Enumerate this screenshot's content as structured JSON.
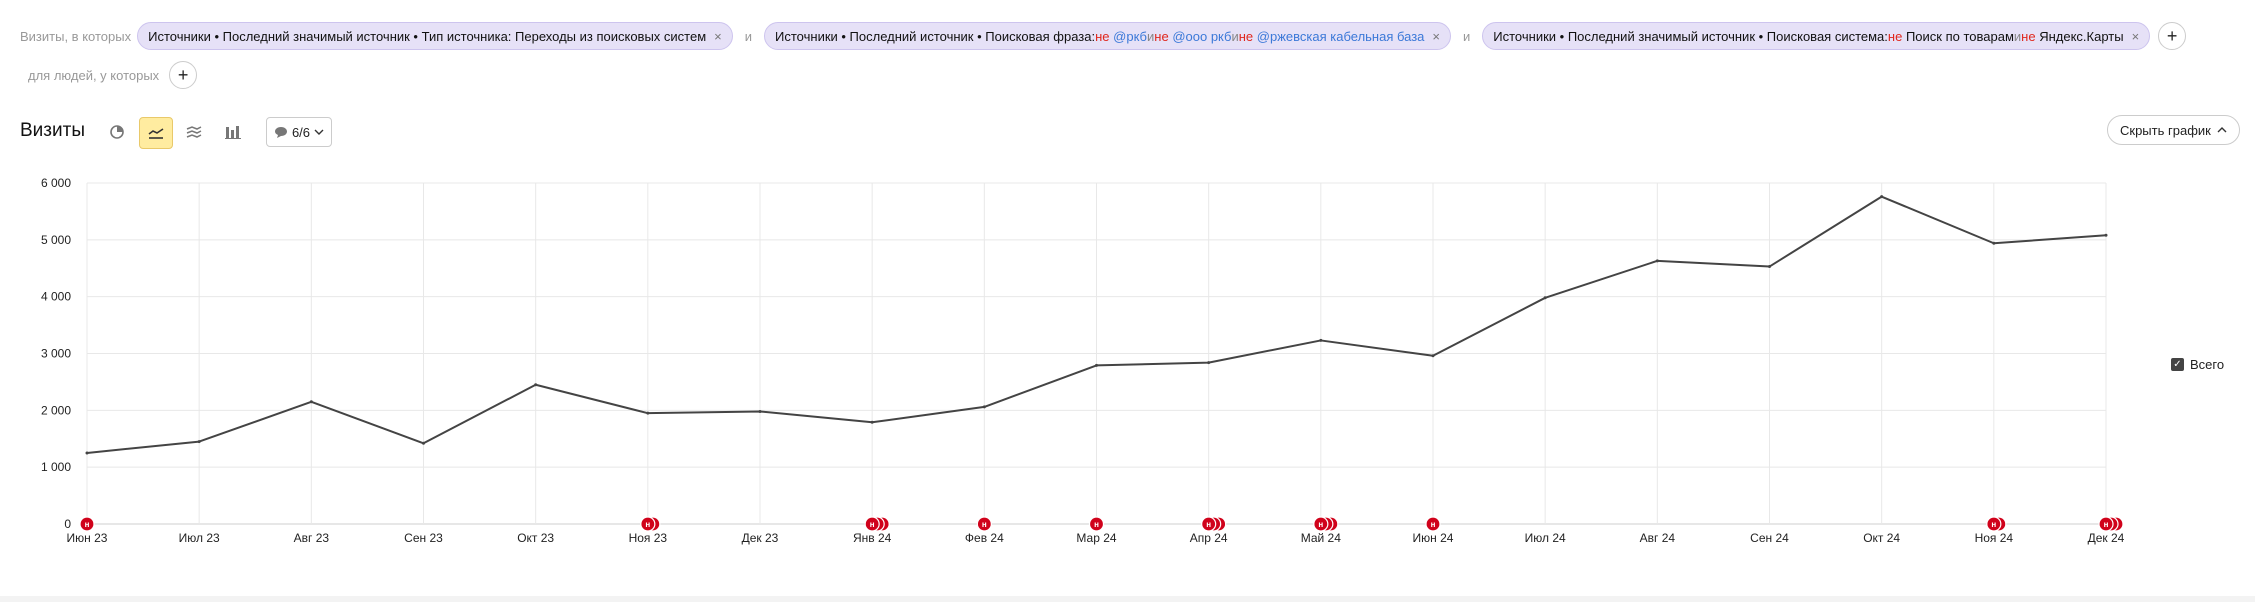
{
  "filters": {
    "lead": "Визиты, в которых",
    "conj": "и",
    "chip1": {
      "text": "Источники • Последний значимый источник • Тип источника: Переходы из поисковых систем"
    },
    "chip2": {
      "prefix": "Источники • Последний источник • Поисковая фраза: ",
      "not": "не",
      "and": " и ",
      "phrase1": "@ркб",
      "phrase2": "@ооо ркб",
      "phrase3": "@ржевская кабельная база"
    },
    "chip3": {
      "prefix": "Источники • Последний значимый источник • Поисковая система: ",
      "not": "не",
      "value1": "Поиск по товарам",
      "and": " и ",
      "value2": "Яндекс.Карты"
    },
    "close_icon": "×",
    "add_icon": "+",
    "people_lead": "для людей, у которых"
  },
  "header": {
    "title": "Визиты",
    "annotations_count": "6/6",
    "hide_chart_label": "Скрыть график",
    "tools": [
      "pie-chart-icon",
      "line-chart-icon",
      "stacked-area-icon",
      "bar-chart-icon",
      "comment-icon"
    ]
  },
  "legend": {
    "label": "Всего",
    "checked": true
  },
  "chart_data": {
    "type": "line",
    "title": "",
    "xlabel": "",
    "ylabel": "",
    "categories": [
      "Июн 23",
      "Июл 23",
      "Авг 23",
      "Сен 23",
      "Окт 23",
      "Ноя 23",
      "Дек 23",
      "Янв 24",
      "Фев 24",
      "Мар 24",
      "Апр 24",
      "Май 24",
      "Июн 24",
      "Июл 24",
      "Авг 24",
      "Сен 24",
      "Окт 24",
      "Ноя 24",
      "Дек 24"
    ],
    "series": [
      {
        "name": "Всего",
        "color": "#444444",
        "values": [
          1250,
          1450,
          2150,
          1420,
          2450,
          1950,
          1980,
          1790,
          2060,
          2790,
          2840,
          3230,
          2960,
          3980,
          4630,
          4530,
          5760,
          4940,
          5080
        ]
      }
    ],
    "yticks": [
      "0",
      "1 000",
      "2 000",
      "3 000",
      "4 000",
      "5 000",
      "6 000"
    ],
    "ylim": [
      0,
      6000
    ],
    "grid": true,
    "legend_position": "right",
    "annotations": [
      {
        "category": "Июн 23",
        "count": 1,
        "label": "н"
      },
      {
        "category": "Ноя 23",
        "count": 2,
        "label": "н"
      },
      {
        "category": "Янв 24",
        "count": 3,
        "label": "н"
      },
      {
        "category": "Фев 24",
        "count": 1,
        "label": "н"
      },
      {
        "category": "Мар 24",
        "count": 1,
        "label": "н"
      },
      {
        "category": "Апр 24",
        "count": 3,
        "label": "н"
      },
      {
        "category": "Май 24",
        "count": 3,
        "label": "н"
      },
      {
        "category": "Июн 24",
        "count": 1,
        "label": "н"
      },
      {
        "category": "Ноя 24",
        "count": 2,
        "label": "н"
      },
      {
        "category": "Дек 24",
        "count": 3,
        "label": "н"
      }
    ],
    "annotation_color": "#d0021b"
  }
}
